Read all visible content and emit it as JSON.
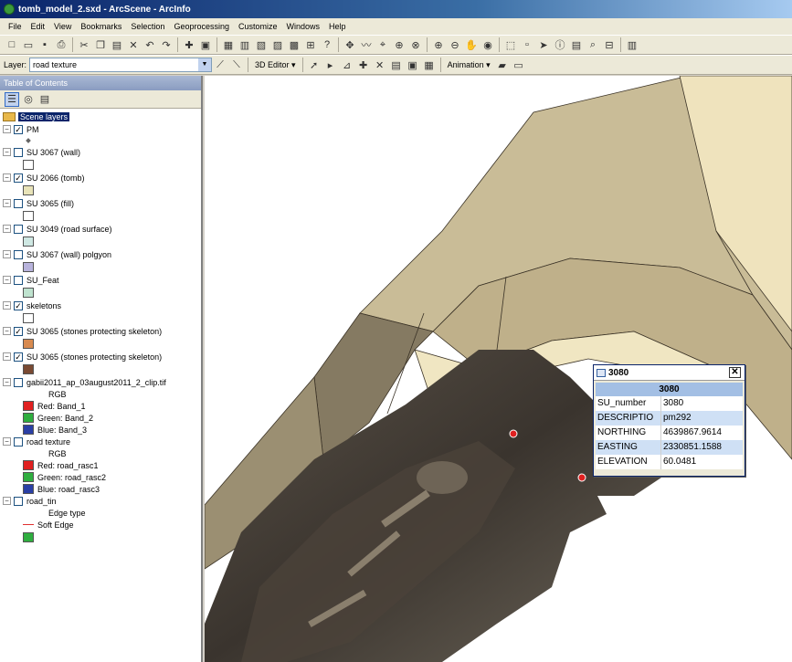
{
  "window": {
    "title": "tomb_model_2.sxd - ArcScene - ArcInfo"
  },
  "menu": [
    "File",
    "Edit",
    "View",
    "Bookmarks",
    "Selection",
    "Geoprocessing",
    "Customize",
    "Windows",
    "Help"
  ],
  "toolbar2": {
    "layer_label": "Layer:",
    "layer_value": "road texture",
    "editor_label": "3D Editor ▾",
    "animation_label": "Animation ▾"
  },
  "toc": {
    "title": "Table of Contents",
    "root": "Scene layers",
    "layers": [
      {
        "name": "PM",
        "checked": true
      },
      {
        "name": "SU 3067 (wall)",
        "checked": false,
        "color": "#ffffff"
      },
      {
        "name": "SU 2066 (tomb)",
        "checked": true,
        "color": "#e8e3b8"
      },
      {
        "name": "SU 3065 (fill)",
        "checked": false,
        "color": "#ffffff"
      },
      {
        "name": "SU 3049 (road surface)",
        "checked": false,
        "color": "#cfe8e3"
      },
      {
        "name": "SU 3067 (wall) polgyon",
        "checked": false,
        "color": "#b8b3dc"
      },
      {
        "name": "SU_Feat",
        "checked": false,
        "color": "#bfe3cf"
      },
      {
        "name": "skeletons",
        "checked": true,
        "color": "#ffffff"
      },
      {
        "name": "SU 3065 (stones protecting skeleton)",
        "checked": true,
        "color": "#d88a4f"
      },
      {
        "name": "SU 3065 (stones protecting skeleton)",
        "checked": true,
        "color": "#7a4a33"
      }
    ],
    "raster1": {
      "name": "gabii2011_ap_03august2011_2_clip.tif",
      "rgb": "RGB",
      "red": "Red:   Band_1",
      "green": "Green: Band_2",
      "blue": "Blue:  Band_3"
    },
    "raster2": {
      "name": "road texture",
      "rgb": "RGB",
      "red": "Red:   road_rasc1",
      "green": "Green: road_rasc2",
      "blue": "Blue:  road_rasc3"
    },
    "tin": {
      "name": "road_tin",
      "edge_type": "Edge type",
      "soft_edge": "Soft Edge"
    }
  },
  "identify": {
    "title": "3080",
    "header": "3080",
    "rows": [
      {
        "k": "SU_number",
        "v": "3080"
      },
      {
        "k": "DESCRIPTIO",
        "v": "pm292"
      },
      {
        "k": "NORTHING",
        "v": "4639867.9614"
      },
      {
        "k": "EASTING",
        "v": "2330851.1588"
      },
      {
        "k": "ELEVATION",
        "v": "60.0481"
      }
    ]
  },
  "colors": {
    "red": "#e02020",
    "green": "#2fae3f",
    "blue": "#2a3fa5",
    "title_bar": "#0a246a"
  }
}
